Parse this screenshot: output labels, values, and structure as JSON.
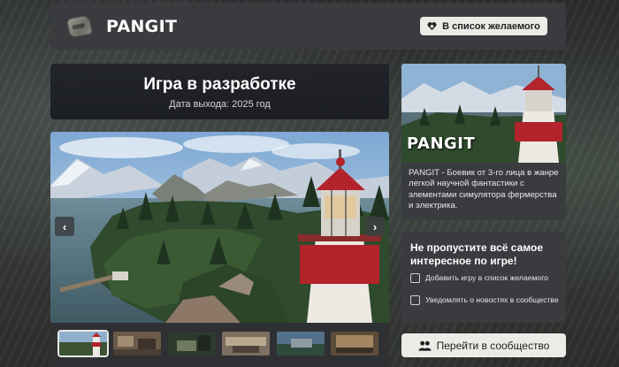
{
  "header": {
    "game_title": "PANGIT",
    "wishlist_button": "В список желаемого"
  },
  "status": {
    "title": "Игра в разработке",
    "release_date": "Дата выхода: 2025 год"
  },
  "media": {
    "prev_arrow": "‹",
    "next_arrow": "›",
    "thumbnail_count": 6,
    "active_thumbnail": 1
  },
  "side": {
    "banner_text": "PANGIT",
    "description": "PANGIT - Боевик от 3-го лица в жанре легкой научной фантастики с элементами симулятора фермерства и электрика."
  },
  "news": {
    "title": "Не пропустите всё самое интересное по игре!",
    "options": [
      "Добавить игру в список желаемого",
      "Уведомлять о новостях в сообществе"
    ]
  },
  "community_button": "Перейти в сообщество",
  "colors": {
    "panel": "#3a3b3f",
    "button_bg": "#ecebe8",
    "lighthouse_red": "#b3232b",
    "sky": "#9fc0de"
  }
}
